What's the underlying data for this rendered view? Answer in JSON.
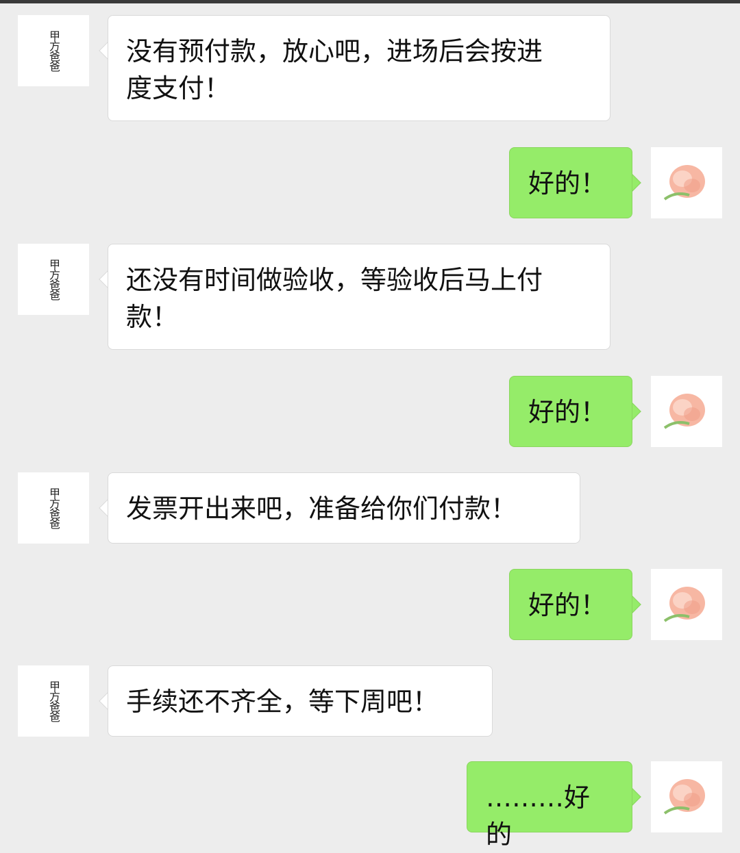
{
  "contact": {
    "name": "甲方爸爸"
  },
  "colors": {
    "background": "#ededed",
    "incoming_bubble": "#ffffff",
    "outgoing_bubble": "#95ec69"
  },
  "self_avatar_icon": "peach-avatar-icon",
  "messages": [
    {
      "sender": "contact",
      "text": "没有预付款，放心吧，进场后会按进\n度支付！"
    },
    {
      "sender": "self",
      "text": "好的！"
    },
    {
      "sender": "contact",
      "text": "还没有时间做验收，等验收后马上付\n款！"
    },
    {
      "sender": "self",
      "text": "好的！"
    },
    {
      "sender": "contact",
      "text": "发票开出来吧，准备给你们付款！"
    },
    {
      "sender": "self",
      "text": "好的！"
    },
    {
      "sender": "contact",
      "text": "手续还不齐全，等下周吧！"
    },
    {
      "sender": "self",
      "text": "………好的"
    }
  ]
}
